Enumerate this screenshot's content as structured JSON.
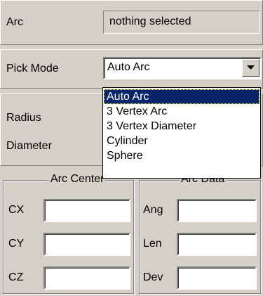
{
  "arc_section": {
    "label": "Arc",
    "status": "nothing selected"
  },
  "pick_mode": {
    "label": "Pick Mode",
    "selected": "Auto Arc",
    "options": [
      "Auto Arc",
      "3 Vertex Arc",
      "3 Vertex Diameter",
      "Cylinder",
      "Sphere"
    ]
  },
  "measurements": {
    "radius_label": "Radius",
    "diameter_label": "Diameter"
  },
  "arc_center": {
    "title": "Arc Center",
    "fields": [
      {
        "label": "CX",
        "value": ""
      },
      {
        "label": "CY",
        "value": ""
      },
      {
        "label": "CZ",
        "value": ""
      }
    ]
  },
  "arc_data": {
    "title": "Arc Data",
    "fields": [
      {
        "label": "Ang",
        "value": ""
      },
      {
        "label": "Len",
        "value": ""
      },
      {
        "label": "Dev",
        "value": ""
      }
    ]
  },
  "colors": {
    "face": "#d4d0c8",
    "highlight": "#0a246a"
  },
  "icons": {
    "dropdown": "chevron-down-icon"
  }
}
